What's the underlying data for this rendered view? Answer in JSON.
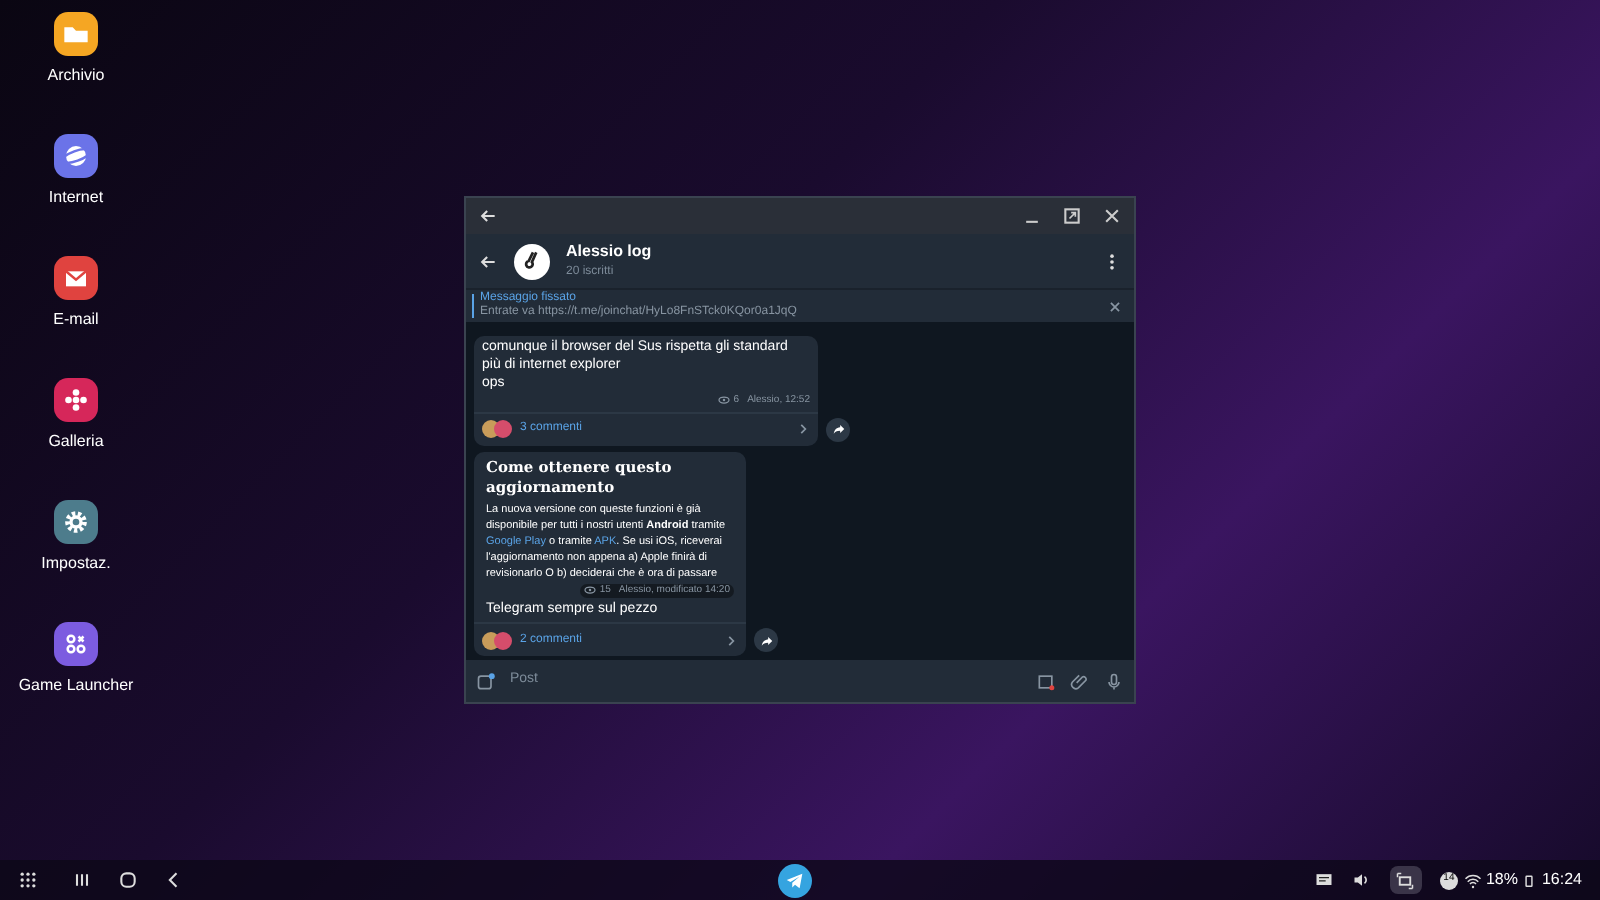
{
  "desktop_icons": [
    {
      "label": "Archivio",
      "kind": "folder",
      "color": "#f5a623"
    },
    {
      "label": "Internet",
      "kind": "planet",
      "color": "#6b73e8"
    },
    {
      "label": "E-mail",
      "kind": "mail",
      "color": "#e0433f"
    },
    {
      "label": "Galleria",
      "kind": "flower",
      "color": "#d6275a"
    },
    {
      "label": "Impostaz.",
      "kind": "gear",
      "color": "#4d7c8c"
    },
    {
      "label": "Game Launcher",
      "kind": "game",
      "color": "#7c5ce0"
    }
  ],
  "window": {
    "chat_title": "Alessio log",
    "subtitle": "20 iscritti",
    "pinned": {
      "title": "Messaggio fissato",
      "text": "Entrate va https://t.me/joinchat/HyLo8FnSTck0KQor0a1JqQ"
    },
    "messages": [
      {
        "kind": "plain",
        "lines": [
          "comunque il browser del Sus rispetta gli standard",
          "più di internet explorer",
          "ops"
        ],
        "views": "6",
        "meta": "Alessio, 12:52",
        "comments": "3 commenti"
      },
      {
        "kind": "article",
        "heading": "Come ottenere questo aggiornamento",
        "body": [
          {
            "kind": "text",
            "text": "La nuova versione con queste funzioni è già disponibile per tutti i nostri utenti "
          },
          {
            "kind": "bold",
            "text": "Android"
          },
          {
            "kind": "text",
            "text": " tramite "
          },
          {
            "kind": "link",
            "text": "Google Play"
          },
          {
            "kind": "text",
            "text": " o tramite "
          },
          {
            "kind": "link",
            "text": "APK"
          },
          {
            "kind": "text",
            "text": ". Se usi iOS, riceverai l'aggiornamento non appena a) Apple finirà di revisionarlo O b) deciderai che è ora di passare"
          }
        ],
        "views": "15",
        "meta": "Alessio, modificato 14:20",
        "caption": "Telegram sempre sul pezzo",
        "comments": "2 commenti"
      }
    ],
    "input_placeholder": "Post"
  },
  "taskbar": {
    "notification_count": "14",
    "battery": "18%",
    "time": "16:24"
  }
}
